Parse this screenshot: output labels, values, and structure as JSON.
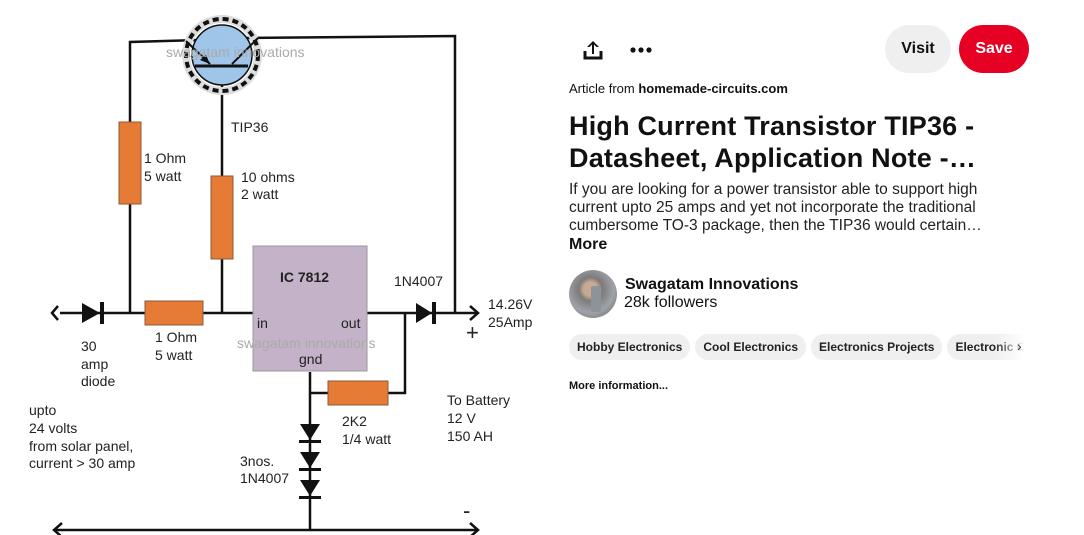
{
  "pin_image": {
    "diagram": {
      "transistor_label": "TIP36",
      "watermark": "swagatam innovations",
      "r1_label": [
        "1 Ohm",
        "5 watt"
      ],
      "r2_label": [
        "10 ohms",
        "2 watt"
      ],
      "r3_label": [
        "1 Ohm",
        "5 watt"
      ],
      "r4_label": [
        "2K2",
        "1/4 watt"
      ],
      "ic_label": "IC 7812",
      "ic_in": "in",
      "ic_out": "out",
      "ic_gnd": "gnd",
      "diode_out_label": "1N4007",
      "output_label": [
        "14.26V",
        "25Amp"
      ],
      "plus": "+",
      "minus": "-",
      "input_diode_label": [
        "30",
        "amp",
        "diode"
      ],
      "input_label": [
        "upto",
        "24 volts",
        "from solar panel,",
        "current > 30 amp"
      ],
      "diodes_label": [
        "3nos.",
        "1N4007"
      ],
      "battery_label": [
        "To Battery",
        "12 V",
        "150 AH"
      ],
      "colors": {
        "resistor": "#e57b35",
        "ic": "#c4b2c8",
        "transistor": "#9fc5e8"
      }
    }
  },
  "toolbar": {
    "share_icon": "share-icon",
    "more_icon": "ellipsis-icon",
    "visit": "Visit",
    "save": "Save"
  },
  "source": {
    "prefix": "Article from",
    "domain": "homemade-circuits.com"
  },
  "title": "High Current Transistor TIP36 - Datasheet, Application Note -…",
  "description": "If you are looking for a power transistor able to support high current upto 25 amps and yet not incorporate the traditional cumbersome TO-3 package, then the TIP36 would certain…",
  "more": "More",
  "creator": {
    "name": "Swagatam Innovations",
    "followers": "28k followers"
  },
  "tags": [
    "Hobby Electronics",
    "Cool Electronics",
    "Electronics Projects",
    "Electronic Ci"
  ],
  "more_information": "More information..."
}
